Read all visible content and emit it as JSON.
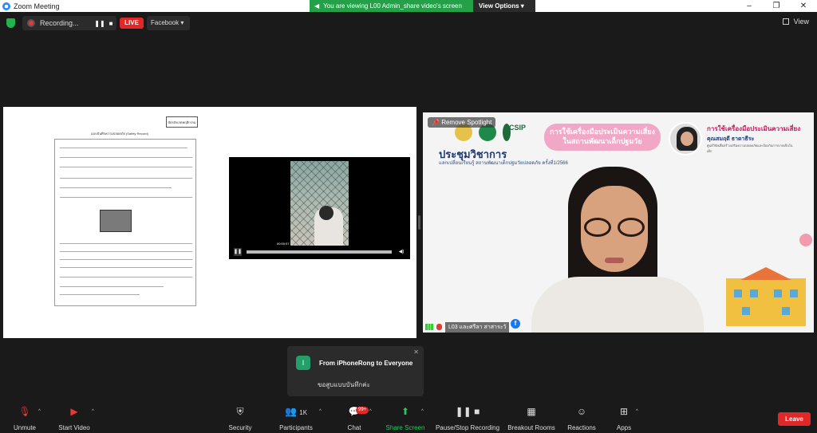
{
  "window": {
    "title": "Zoom Meeting",
    "controls": [
      "–",
      "❐",
      "✕"
    ]
  },
  "banner": {
    "viewing_text": "You are viewing L00 Admin_share video's screen",
    "view_options_label": "View Options"
  },
  "top": {
    "recording_label": "Recording...",
    "live_label": "LIVE",
    "stream_target": "Facebook",
    "view_label": "View"
  },
  "share": {
    "doc_stamp": "บัตรสังเกตพฤติกรรม",
    "doc_header": "แบบบันทึกความปลอดภัย (Safety Record)",
    "video_time": "00:00:57"
  },
  "speaker": {
    "remove_spotlight": "Remove Spotlight",
    "csip_logo": "CSIP",
    "pink_title": "การใช้เครื่องมือประเมินความเสี่ยงในสถานพัฒนาเด็กปฐมวัย",
    "main_title": "ประชุมวิชาการ",
    "sub_title": "แลกเปลี่ยนเรียนรู้ สถานพัฒนาเด็กปฐมวัยปลอดภัย ครั้งที่1/2566",
    "right_title": "การใช้เครื่องมือประเมินความเสี่ยง",
    "right_name": "คุณสมฤดี ธาดาธีระ",
    "right_sub": "ศูนย์วิจัยเพื่อสร้างเสริมความปลอดภัยและป้องกันการบาดเจ็บในเด็ก",
    "participant_name": "L03 และศรีลา สาสาระวั",
    "fb_glyph": "f"
  },
  "chat_popup": {
    "initial": "I",
    "from_text": "From iPhoneRong to Everyone",
    "message": "ขอสูบแบบบันทึกค่ะ",
    "close_glyph": "✕"
  },
  "toolbar": {
    "unmute": "Unmute",
    "start_video": "Start Video",
    "security": "Security",
    "participants": "Participants",
    "participants_count": "1K",
    "chat": "Chat",
    "chat_badge": "99+",
    "share_screen": "Share Screen",
    "pause_recording": "Pause/Stop Recording",
    "breakout": "Breakout Rooms",
    "reactions": "Reactions",
    "apps": "Apps",
    "leave": "Leave"
  },
  "colors": {
    "live": "#e02828",
    "share_green": "#27c95f",
    "banner_green": "#24a148",
    "leave": "#e02828"
  }
}
